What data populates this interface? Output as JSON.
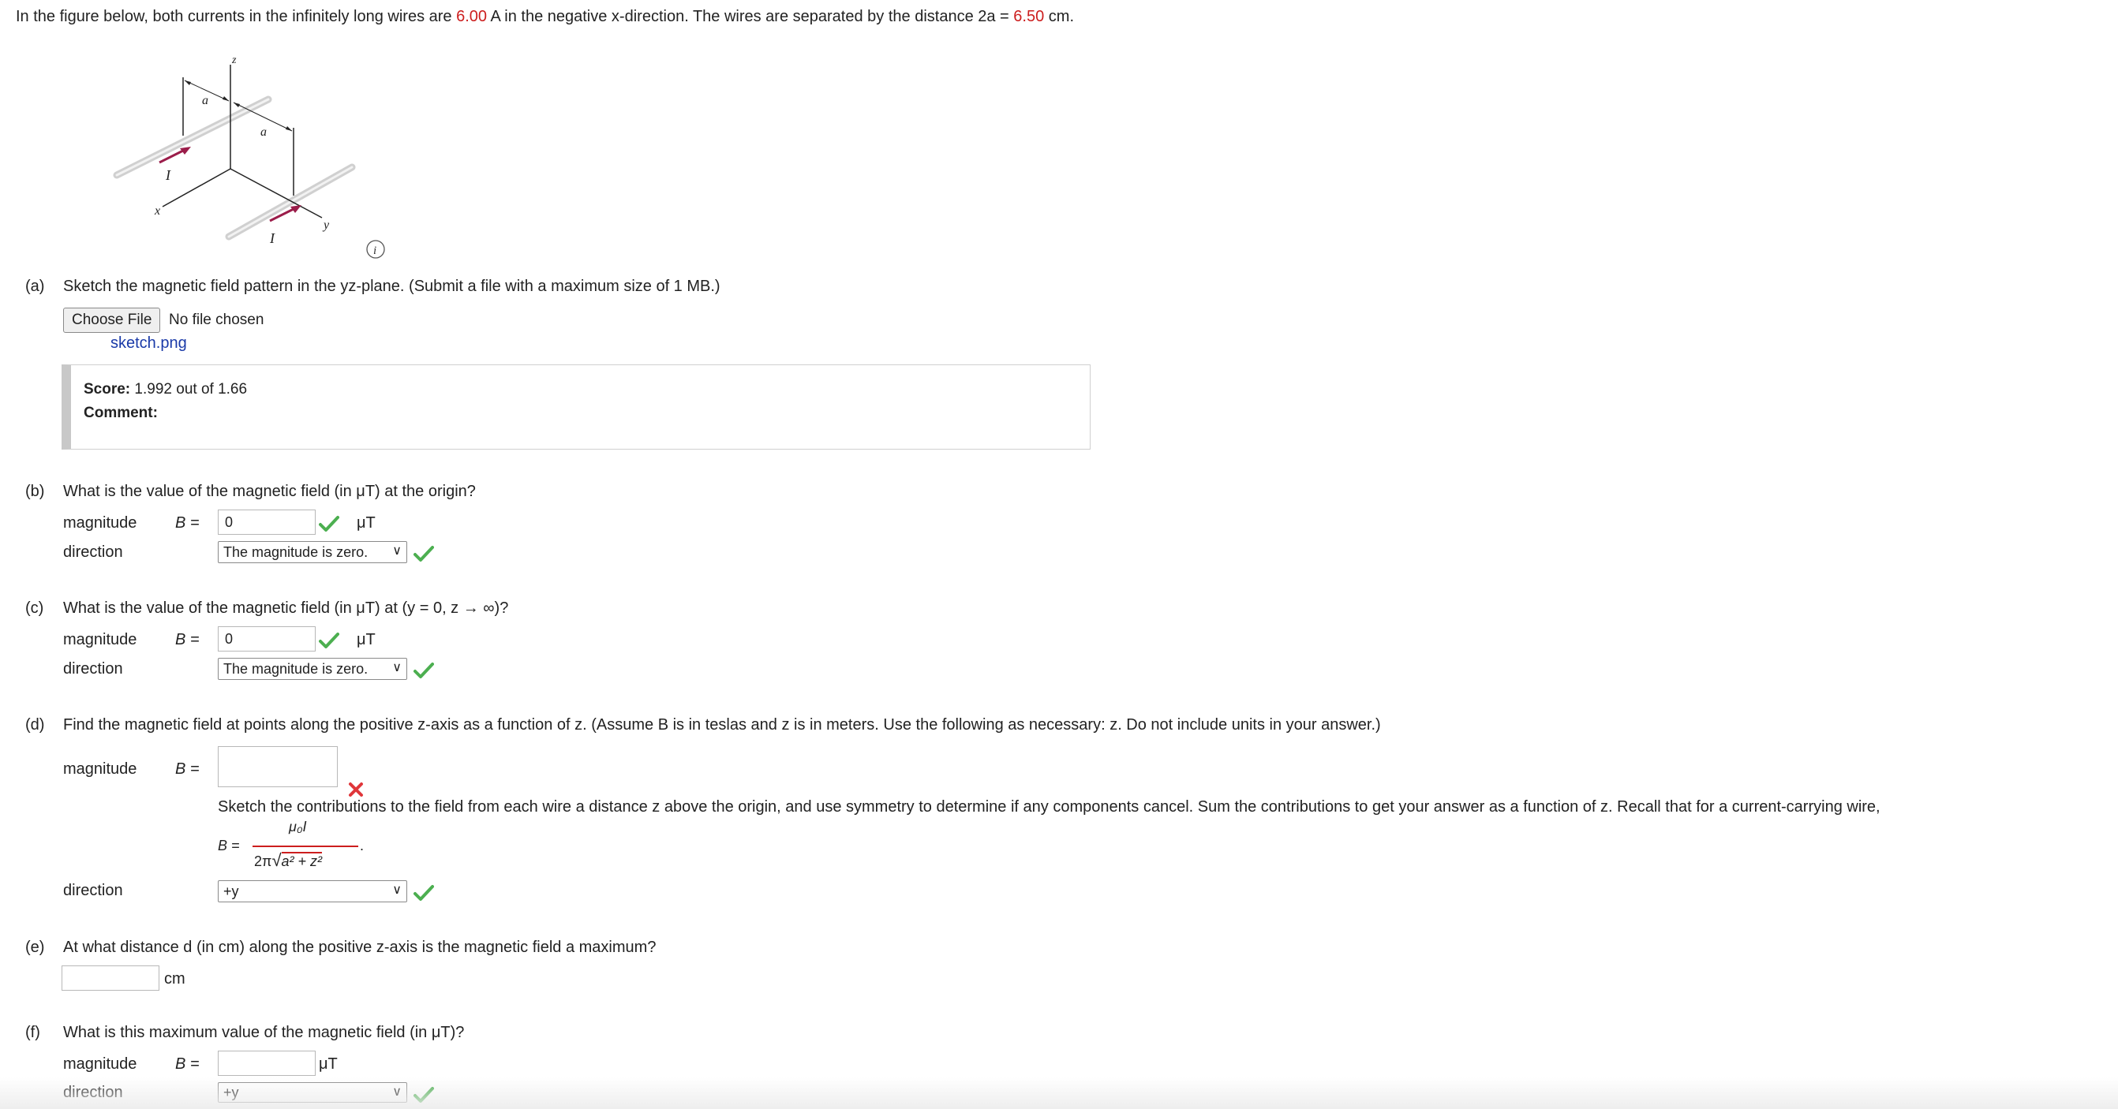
{
  "intro": {
    "prefix": "In the figure below, both currents in the infinitely long wires are ",
    "current": "6.00",
    "mid": " A in the negative x-direction. The wires are separated by the distance 2a = ",
    "distance": "6.50",
    "suffix": " cm."
  },
  "figure": {
    "label_z": "z",
    "label_a1": "a",
    "label_a2": "a",
    "label_x": "x",
    "label_y": "y",
    "label_I1": "I",
    "label_I2": "I",
    "info_icon": "i"
  },
  "part_a": {
    "letter": "(a)",
    "question": "Sketch the magnetic field pattern in the yz-plane. (Submit a file with a maximum size of 1 MB.)",
    "choose_file": "Choose File",
    "no_file": "No file chosen",
    "uploaded": "sketch.png",
    "score_label": "Score:",
    "score_value": "1.992 out of 1.66",
    "comment_label": "Comment:"
  },
  "part_b": {
    "letter": "(b)",
    "question": "What is the value of the magnetic field (in μT) at the origin?",
    "magnitude_label": "magnitude",
    "b_label": "B =",
    "magnitude_value": "0",
    "unit": "μT",
    "direction_label": "direction",
    "direction_value": "The magnitude is zero."
  },
  "part_c": {
    "letter": "(c)",
    "question": "What is the value of the magnetic field (in μT) at (y = 0, z → ∞)?",
    "magnitude_label": "magnitude",
    "b_label": "B =",
    "magnitude_value": "0",
    "unit": "μT",
    "direction_label": "direction",
    "direction_value": "The magnitude is zero."
  },
  "part_d": {
    "letter": "(d)",
    "question": "Find the magnetic field at points along the positive z-axis as a function of z. (Assume B is in teslas and z is in meters. Use the following as necessary: z. Do not include units in your answer.)",
    "magnitude_label": "magnitude",
    "b_label": "B =",
    "magnitude_value": "",
    "hint": "Sketch the contributions to the field from each wire a distance z above the origin, and use symmetry to determine if any components cancel. Sum the contributions to get your answer as a function of z. Recall that for a current-carrying wire,",
    "formula_lhs": "B =",
    "formula_num": "μ₀I",
    "formula_den_prefix": "2π",
    "formula_den_root": "a² + z²",
    "formula_end": ".",
    "direction_label": "direction",
    "direction_value": "+y"
  },
  "part_e": {
    "letter": "(e)",
    "question": "At what distance d (in cm) along the positive z-axis is the magnetic field a maximum?",
    "value": "",
    "unit": "cm"
  },
  "part_f": {
    "letter": "(f)",
    "question": "What is this maximum value of the magnetic field (in μT)?",
    "magnitude_label": "magnitude",
    "b_label": "B =",
    "magnitude_value": "",
    "unit": "μT",
    "direction_label": "direction",
    "direction_value": "+y"
  },
  "colors": {
    "red": "#cc1e1e",
    "check_green": "#4caf50",
    "wire_arrow": "#9b1d4a"
  }
}
